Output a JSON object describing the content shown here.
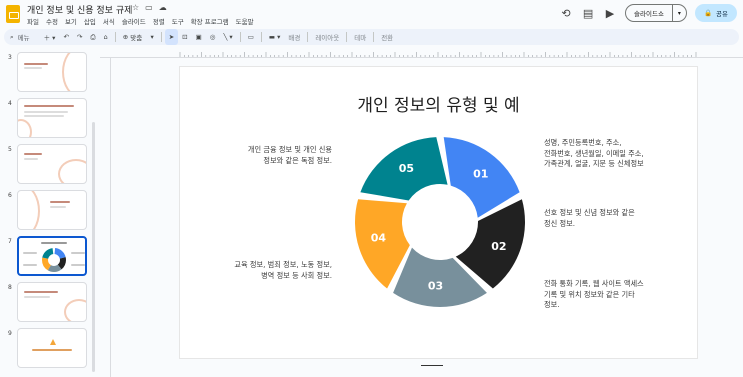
{
  "window": {
    "title": "개인 정보 및 신용 정보 규제",
    "menu": [
      "파일",
      "수정",
      "보기",
      "삽입",
      "서식",
      "슬라이드",
      "정렬",
      "도구",
      "확장 프로그램",
      "도움말"
    ]
  },
  "header_actions": {
    "slideshow_label": "슬라이드쇼",
    "share_label": "공유"
  },
  "toolbar": {
    "search_placeholder": "메뉴",
    "zoom_label": "맞춤",
    "background_label": "배경",
    "layout_label": "레이아웃",
    "theme_label": "테마",
    "transition_label": "전환"
  },
  "filmstrip": {
    "slides": [
      {
        "number": "3"
      },
      {
        "number": "4"
      },
      {
        "number": "5"
      },
      {
        "number": "6"
      },
      {
        "number": "7",
        "active": true
      },
      {
        "number": "8"
      },
      {
        "number": "9"
      }
    ]
  },
  "slide": {
    "title": "개인 정보의 유형 및 예",
    "left_desc_top": "개인 금융 정보 및 개인 신용\n정보와 같은 독점 정보.",
    "left_desc_bottom": "교육 정보, 범죄 정보, 노동 정보,\n병역 정보 등 사회 정보.",
    "right_desc_1": "성명, 주민등록번호, 주소,\n전화번호, 생년월일, 이메일 주소,\n가족관계, 얼굴, 지문 등 신체정보",
    "right_desc_2": "선호 정보 및 신념 정보와 같은\n정신 정보.",
    "right_desc_3": "전화 통화 기록, 웹 사이트 액세스\n기록 및 위치 정보와 같은 기타\n정보.",
    "segments": [
      {
        "label": "01",
        "color": "#4285f4"
      },
      {
        "label": "02",
        "color": "#212121"
      },
      {
        "label": "03",
        "color": "#78909c"
      },
      {
        "label": "04",
        "color": "#ffa726"
      },
      {
        "label": "05",
        "color": "#00838f"
      }
    ]
  }
}
